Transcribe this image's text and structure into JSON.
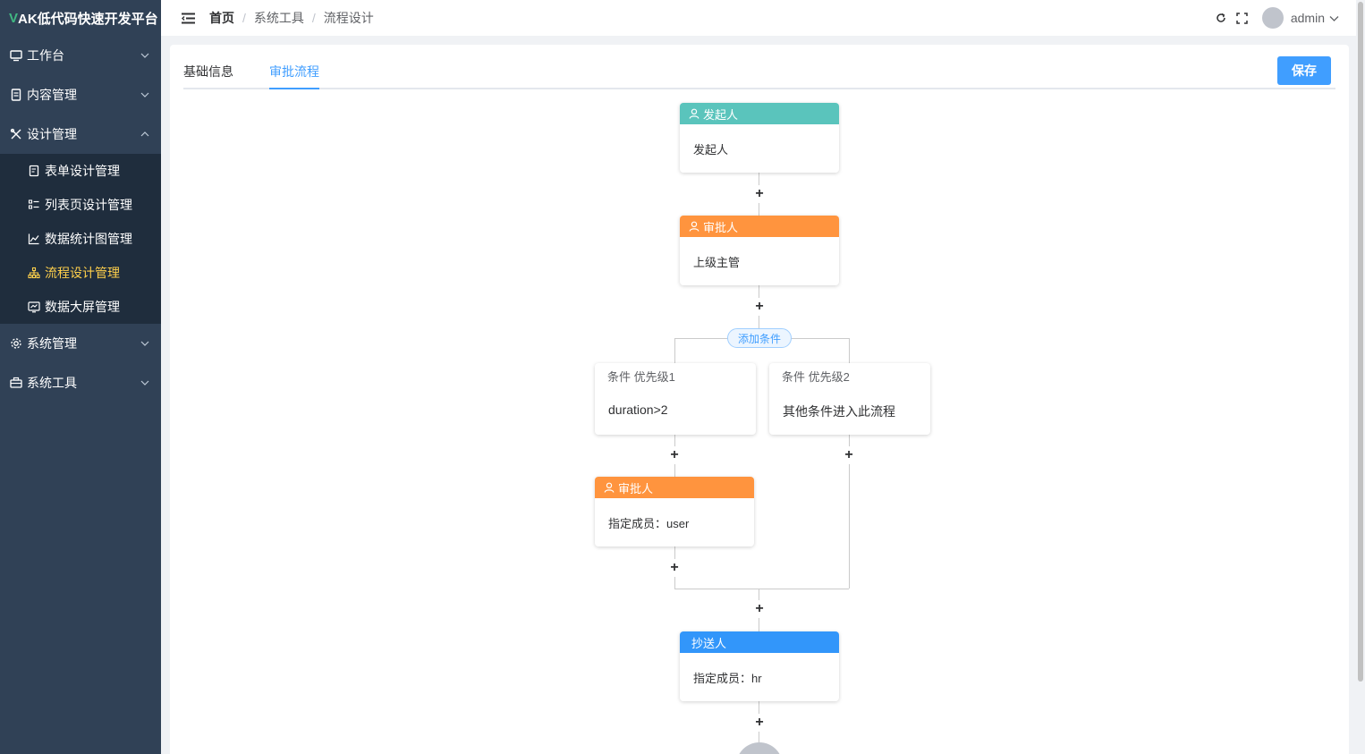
{
  "app": {
    "logo_mark": "V",
    "logo_text": "AK低代码快速开发平台"
  },
  "sidebar": {
    "items": [
      {
        "label": "工作台",
        "icon": "monitor-icon",
        "expanded": false
      },
      {
        "label": "内容管理",
        "icon": "document-icon",
        "expanded": false
      },
      {
        "label": "设计管理",
        "icon": "tools-icon",
        "expanded": true,
        "children": [
          {
            "label": "表单设计管理",
            "icon": "form-icon"
          },
          {
            "label": "列表页设计管理",
            "icon": "list-icon"
          },
          {
            "label": "数据统计图管理",
            "icon": "chart-icon"
          },
          {
            "label": "流程设计管理",
            "icon": "flow-icon",
            "active": true
          },
          {
            "label": "数据大屏管理",
            "icon": "screen-icon"
          }
        ]
      },
      {
        "label": "系统管理",
        "icon": "gear-icon",
        "expanded": false
      },
      {
        "label": "系统工具",
        "icon": "toolbox-icon",
        "expanded": false
      }
    ]
  },
  "header": {
    "breadcrumb": [
      "首页",
      "系统工具",
      "流程设计"
    ],
    "separator": "/",
    "username": "admin"
  },
  "tabs": [
    {
      "label": "基础信息",
      "active": false
    },
    {
      "label": "审批流程",
      "active": true
    }
  ],
  "save_label": "保存",
  "flow": {
    "start": {
      "title": "发起人",
      "content": "发起人",
      "color": "#5ac4bc"
    },
    "approver1": {
      "title": "审批人",
      "content": "上级主管",
      "color": "#ff943e"
    },
    "add_condition": "添加条件",
    "conditions": [
      {
        "title": "条件 优先级1",
        "content": "duration>2"
      },
      {
        "title": "条件 优先级2",
        "content": "其他条件进入此流程"
      }
    ],
    "approver2": {
      "title": "审批人",
      "content": "指定成员：user",
      "color": "#ff943e"
    },
    "cc": {
      "title": "抄送人",
      "content": "指定成员：hr",
      "color": "#3296fa"
    },
    "add_symbol": "+"
  },
  "colors": {
    "sidebar_bg": "#304156",
    "active_menu": "#ffd04b",
    "primary": "#409eff"
  }
}
